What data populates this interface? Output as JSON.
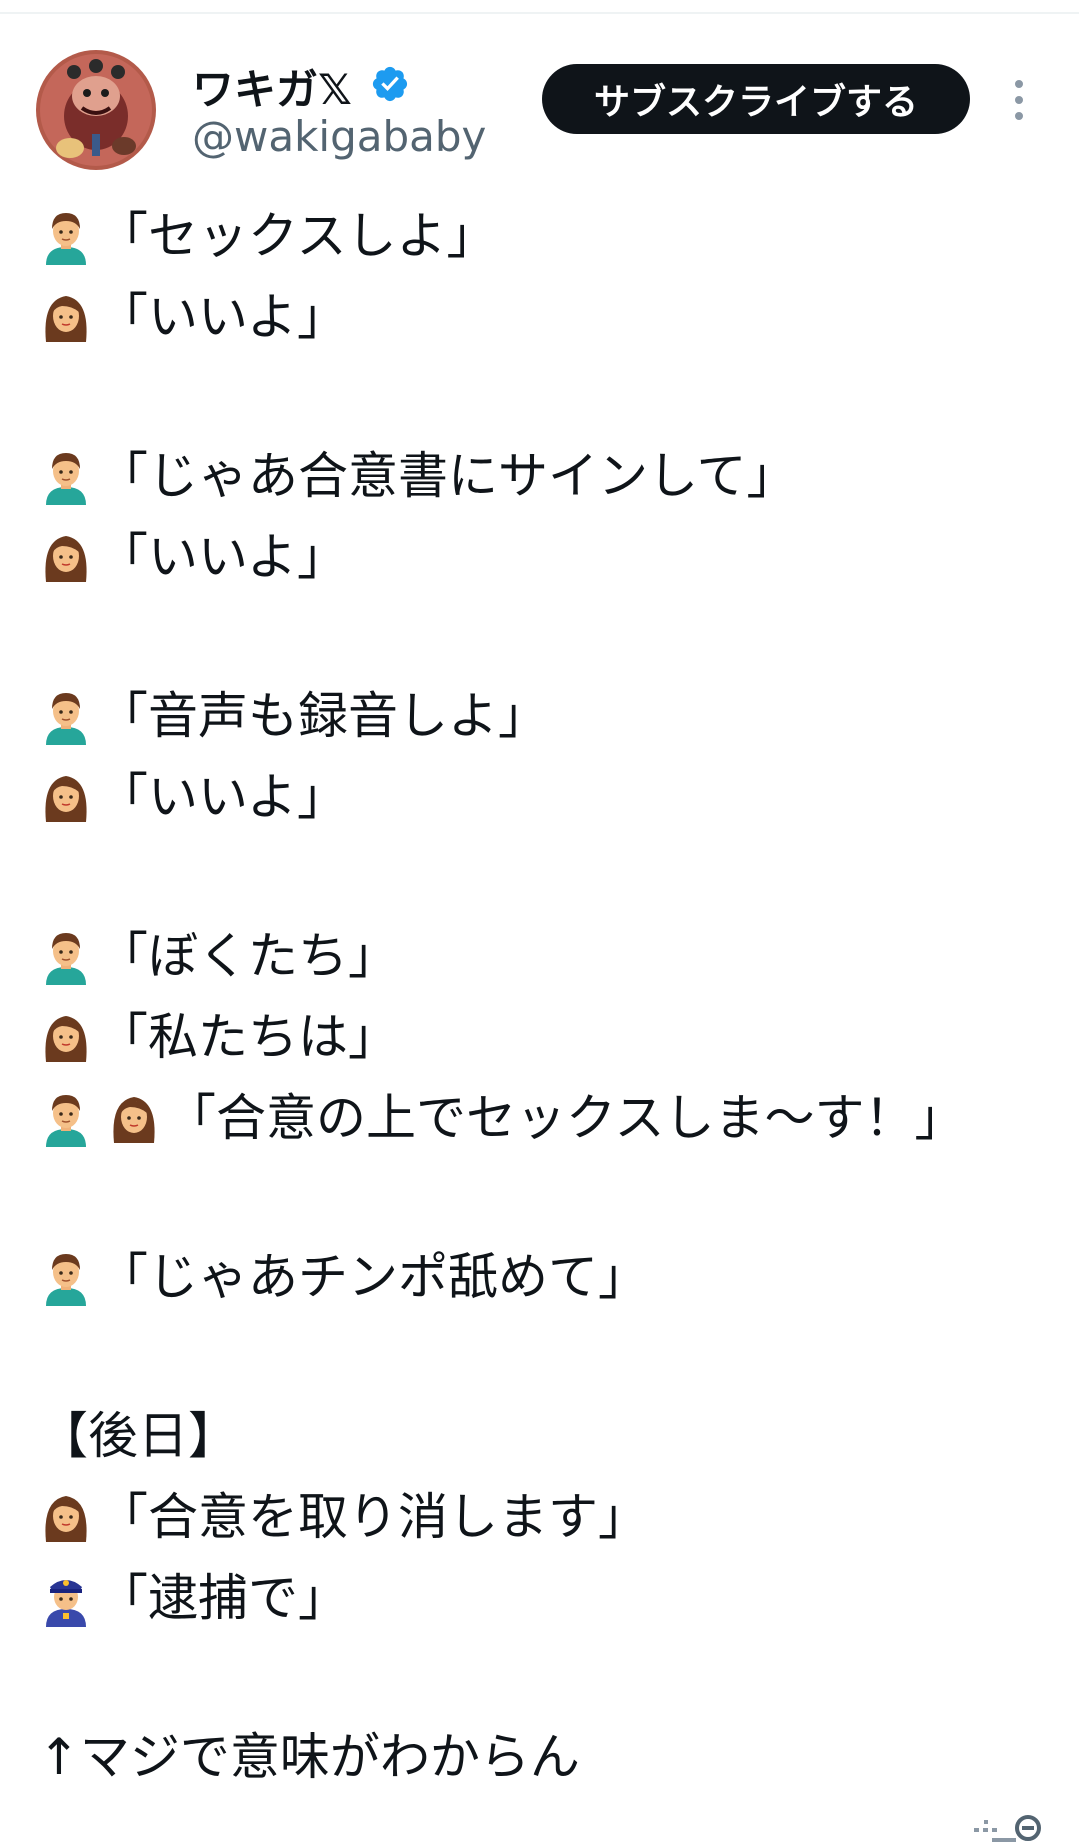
{
  "tweet": {
    "display_name": "ワキガ𝕏",
    "handle": "@wakigababy",
    "subscribe_label": "サブスクライブする",
    "verified_color": "#1d9bf0"
  },
  "lines": [
    {
      "speaker": "man",
      "text": "「セックスしよ」"
    },
    {
      "speaker": "woman",
      "text": "「いいよ」"
    },
    {
      "speaker": "",
      "text": ""
    },
    {
      "speaker": "man",
      "text": "「じゃあ合意書にサインして」"
    },
    {
      "speaker": "woman",
      "text": "「いいよ」"
    },
    {
      "speaker": "",
      "text": ""
    },
    {
      "speaker": "man",
      "text": "「音声も録音しよ」"
    },
    {
      "speaker": "woman",
      "text": "「いいよ」"
    },
    {
      "speaker": "",
      "text": ""
    },
    {
      "speaker": "man",
      "text": "「ぼくたち」"
    },
    {
      "speaker": "woman",
      "text": "「私たちは」"
    },
    {
      "speaker": "man+woman",
      "text": "「合意の上でセックスしま〜す！」"
    },
    {
      "speaker": "",
      "text": ""
    },
    {
      "speaker": "man",
      "text": "「じゃあチンポ舐めて」"
    },
    {
      "speaker": "",
      "text": ""
    },
    {
      "speaker": "",
      "text": "【後日】"
    },
    {
      "speaker": "woman",
      "text": "「合意を取り消します」"
    },
    {
      "speaker": "police",
      "text": "「逮捕で」"
    },
    {
      "speaker": "",
      "text": ""
    },
    {
      "speaker": "",
      "text": "↑マジで意味がわからん"
    }
  ],
  "icons": {
    "man": "man-emoji-icon",
    "woman": "woman-emoji-icon",
    "police": "police-officer-emoji-icon",
    "more": "more-options-icon",
    "verified": "verified-badge-icon",
    "footer": "text-size-icon"
  }
}
